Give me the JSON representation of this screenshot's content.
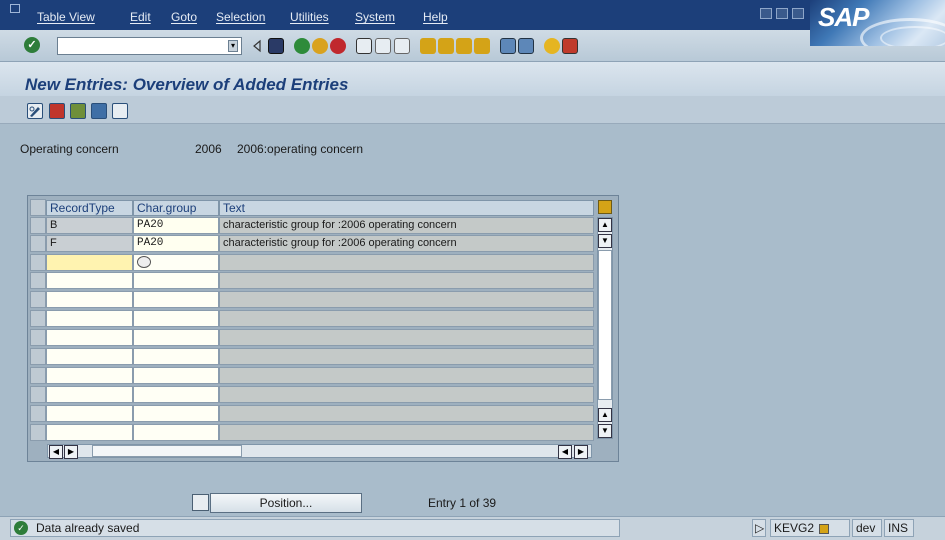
{
  "menu": {
    "items": [
      "Table View",
      "Edit",
      "Goto",
      "Selection",
      "Utilities",
      "System",
      "Help"
    ]
  },
  "logo": "SAP",
  "title": "New Entries: Overview of Added Entries",
  "field": {
    "label": "Operating concern",
    "value": "2006",
    "description": "2006:operating concern"
  },
  "table": {
    "headers": [
      "RecordType",
      "Char.group",
      "Text"
    ],
    "rows": [
      {
        "record_type": "B",
        "char_group": "PA20",
        "text": "characteristic group for :2006 operating concern"
      },
      {
        "record_type": "F",
        "char_group": "PA20",
        "text": "characteristic group for :2006 operating concern"
      }
    ]
  },
  "position_button": "Position...",
  "entry_info": "Entry 1 of 39",
  "status": {
    "message": "Data already saved",
    "transaction": "KEVG2",
    "client": "dev",
    "mode": "INS"
  },
  "icons": {
    "ok": "check-icon",
    "save": "save-icon",
    "back": "back-icon",
    "exit": "exit-icon",
    "cancel": "cancel-icon",
    "print": "print-icon",
    "find": "find-icon",
    "help": "help-icon",
    "choose": "pencil-icon",
    "settings": "table-settings-icon"
  },
  "colors": {
    "menubar": "#1c3f7a",
    "title": "#1c3f7a",
    "background": "#a9bccb",
    "status_ok": "#2e7d3a"
  }
}
